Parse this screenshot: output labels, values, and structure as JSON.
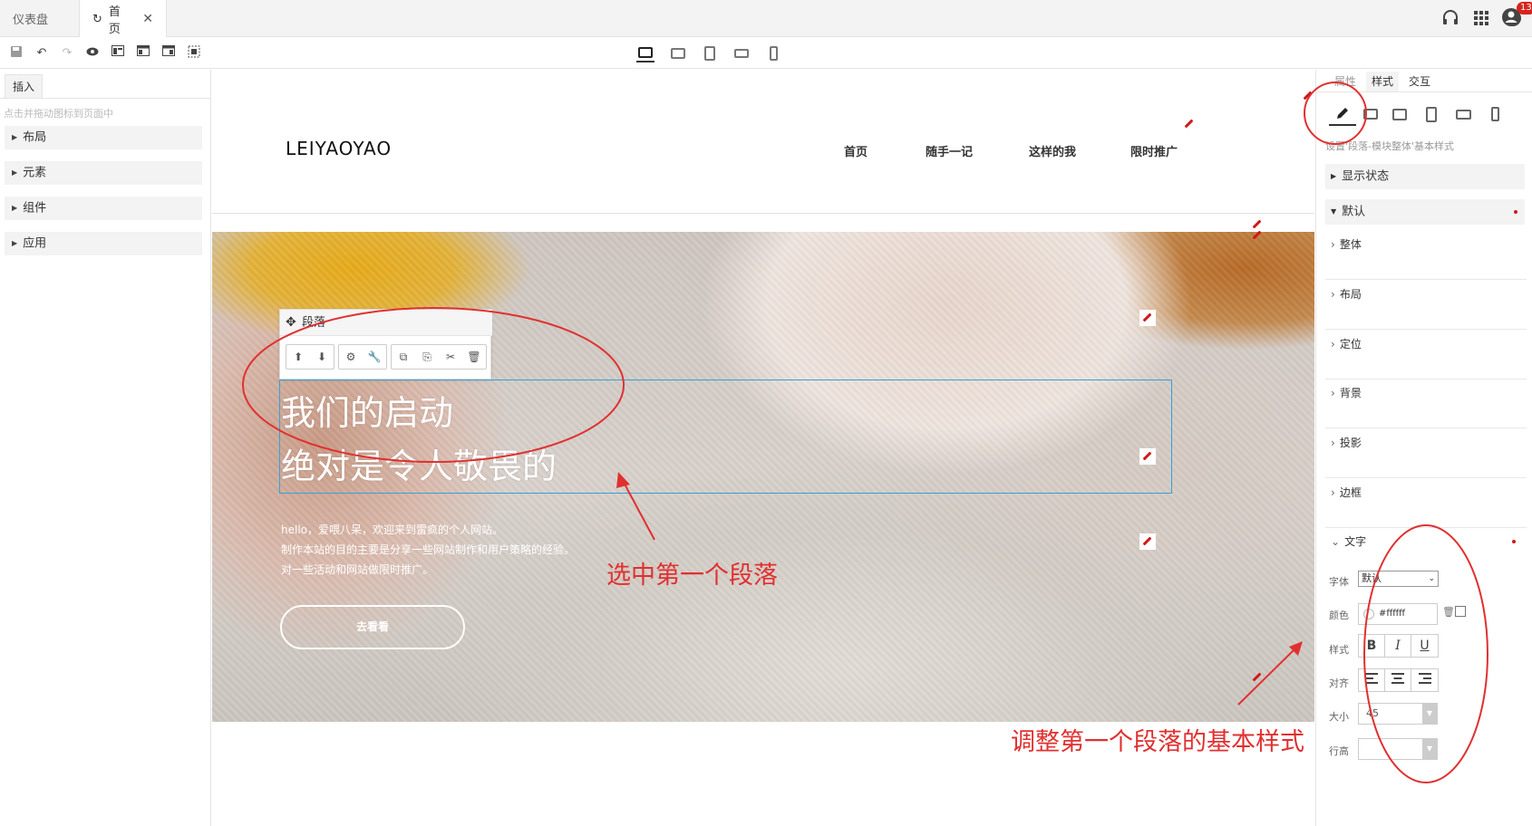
{
  "tabs": {
    "dashboard": "仪表盘",
    "home": "首页"
  },
  "topbar": {
    "icons": [
      "headset-icon",
      "grid-icon",
      "notification-icon",
      "user-icon"
    ],
    "badge_count": "13"
  },
  "toolbar": {
    "left_icons": [
      "save-icon",
      "undo-icon",
      "redo-icon",
      "preview-icon",
      "layout1-icon",
      "layout2-icon",
      "layout3-icon",
      "select-icon"
    ],
    "devices": [
      "desktop",
      "laptop",
      "tablet",
      "tablet-landscape",
      "mobile"
    ]
  },
  "left": {
    "tab_label": "插入",
    "hint": "点击并拖动图标到页面中",
    "categories": [
      "布局",
      "元素",
      "组件",
      "应用"
    ]
  },
  "site": {
    "logo": "LEIYAOYAO",
    "nav": [
      "首页",
      "随手一记",
      "这样的我",
      "限时推广"
    ],
    "hero_title_line1": "我们的启动",
    "hero_title_line2": "绝对是令人敬畏的",
    "hero_text_1": "hello，爱喂八呆，欢迎来到雷疯的个人网站。",
    "hero_text_2": "制作本站的目的主要是分享一些网站制作和用户策略的经验。",
    "hero_text_3": "对一些活动和网站做限时推广。",
    "hero_button": "去看看"
  },
  "floating_toolbar": {
    "title": "段落"
  },
  "right": {
    "tabs": [
      "属性",
      "样式",
      "交互"
    ],
    "hint": "设置'段落-模块整体'基本样式",
    "sections": {
      "display_state": "显示状态",
      "default": "默认",
      "whole": "整体",
      "layout": "布局",
      "position": "定位",
      "background": "背景",
      "shadow": "投影",
      "border": "边框",
      "text": "文字"
    },
    "fields": {
      "font_label": "字体",
      "font_value": "默认",
      "color_label": "颜色",
      "color_value": "#ffffff",
      "style_label": "样式",
      "align_label": "对齐",
      "size_label": "大小",
      "size_value": "45",
      "lineheight_label": "行高"
    },
    "style_buttons": [
      "B",
      "I",
      "U"
    ],
    "align_buttons": [
      "≡",
      "≡",
      "≡"
    ]
  },
  "annotations": {
    "select_paragraph": "选中第一个段落",
    "adjust_style": "调整第一个段落的基本样式"
  },
  "colors": {
    "accent_red": "#e03030",
    "selection_blue": "#34a0d8",
    "badge_red": "#d9231d"
  }
}
